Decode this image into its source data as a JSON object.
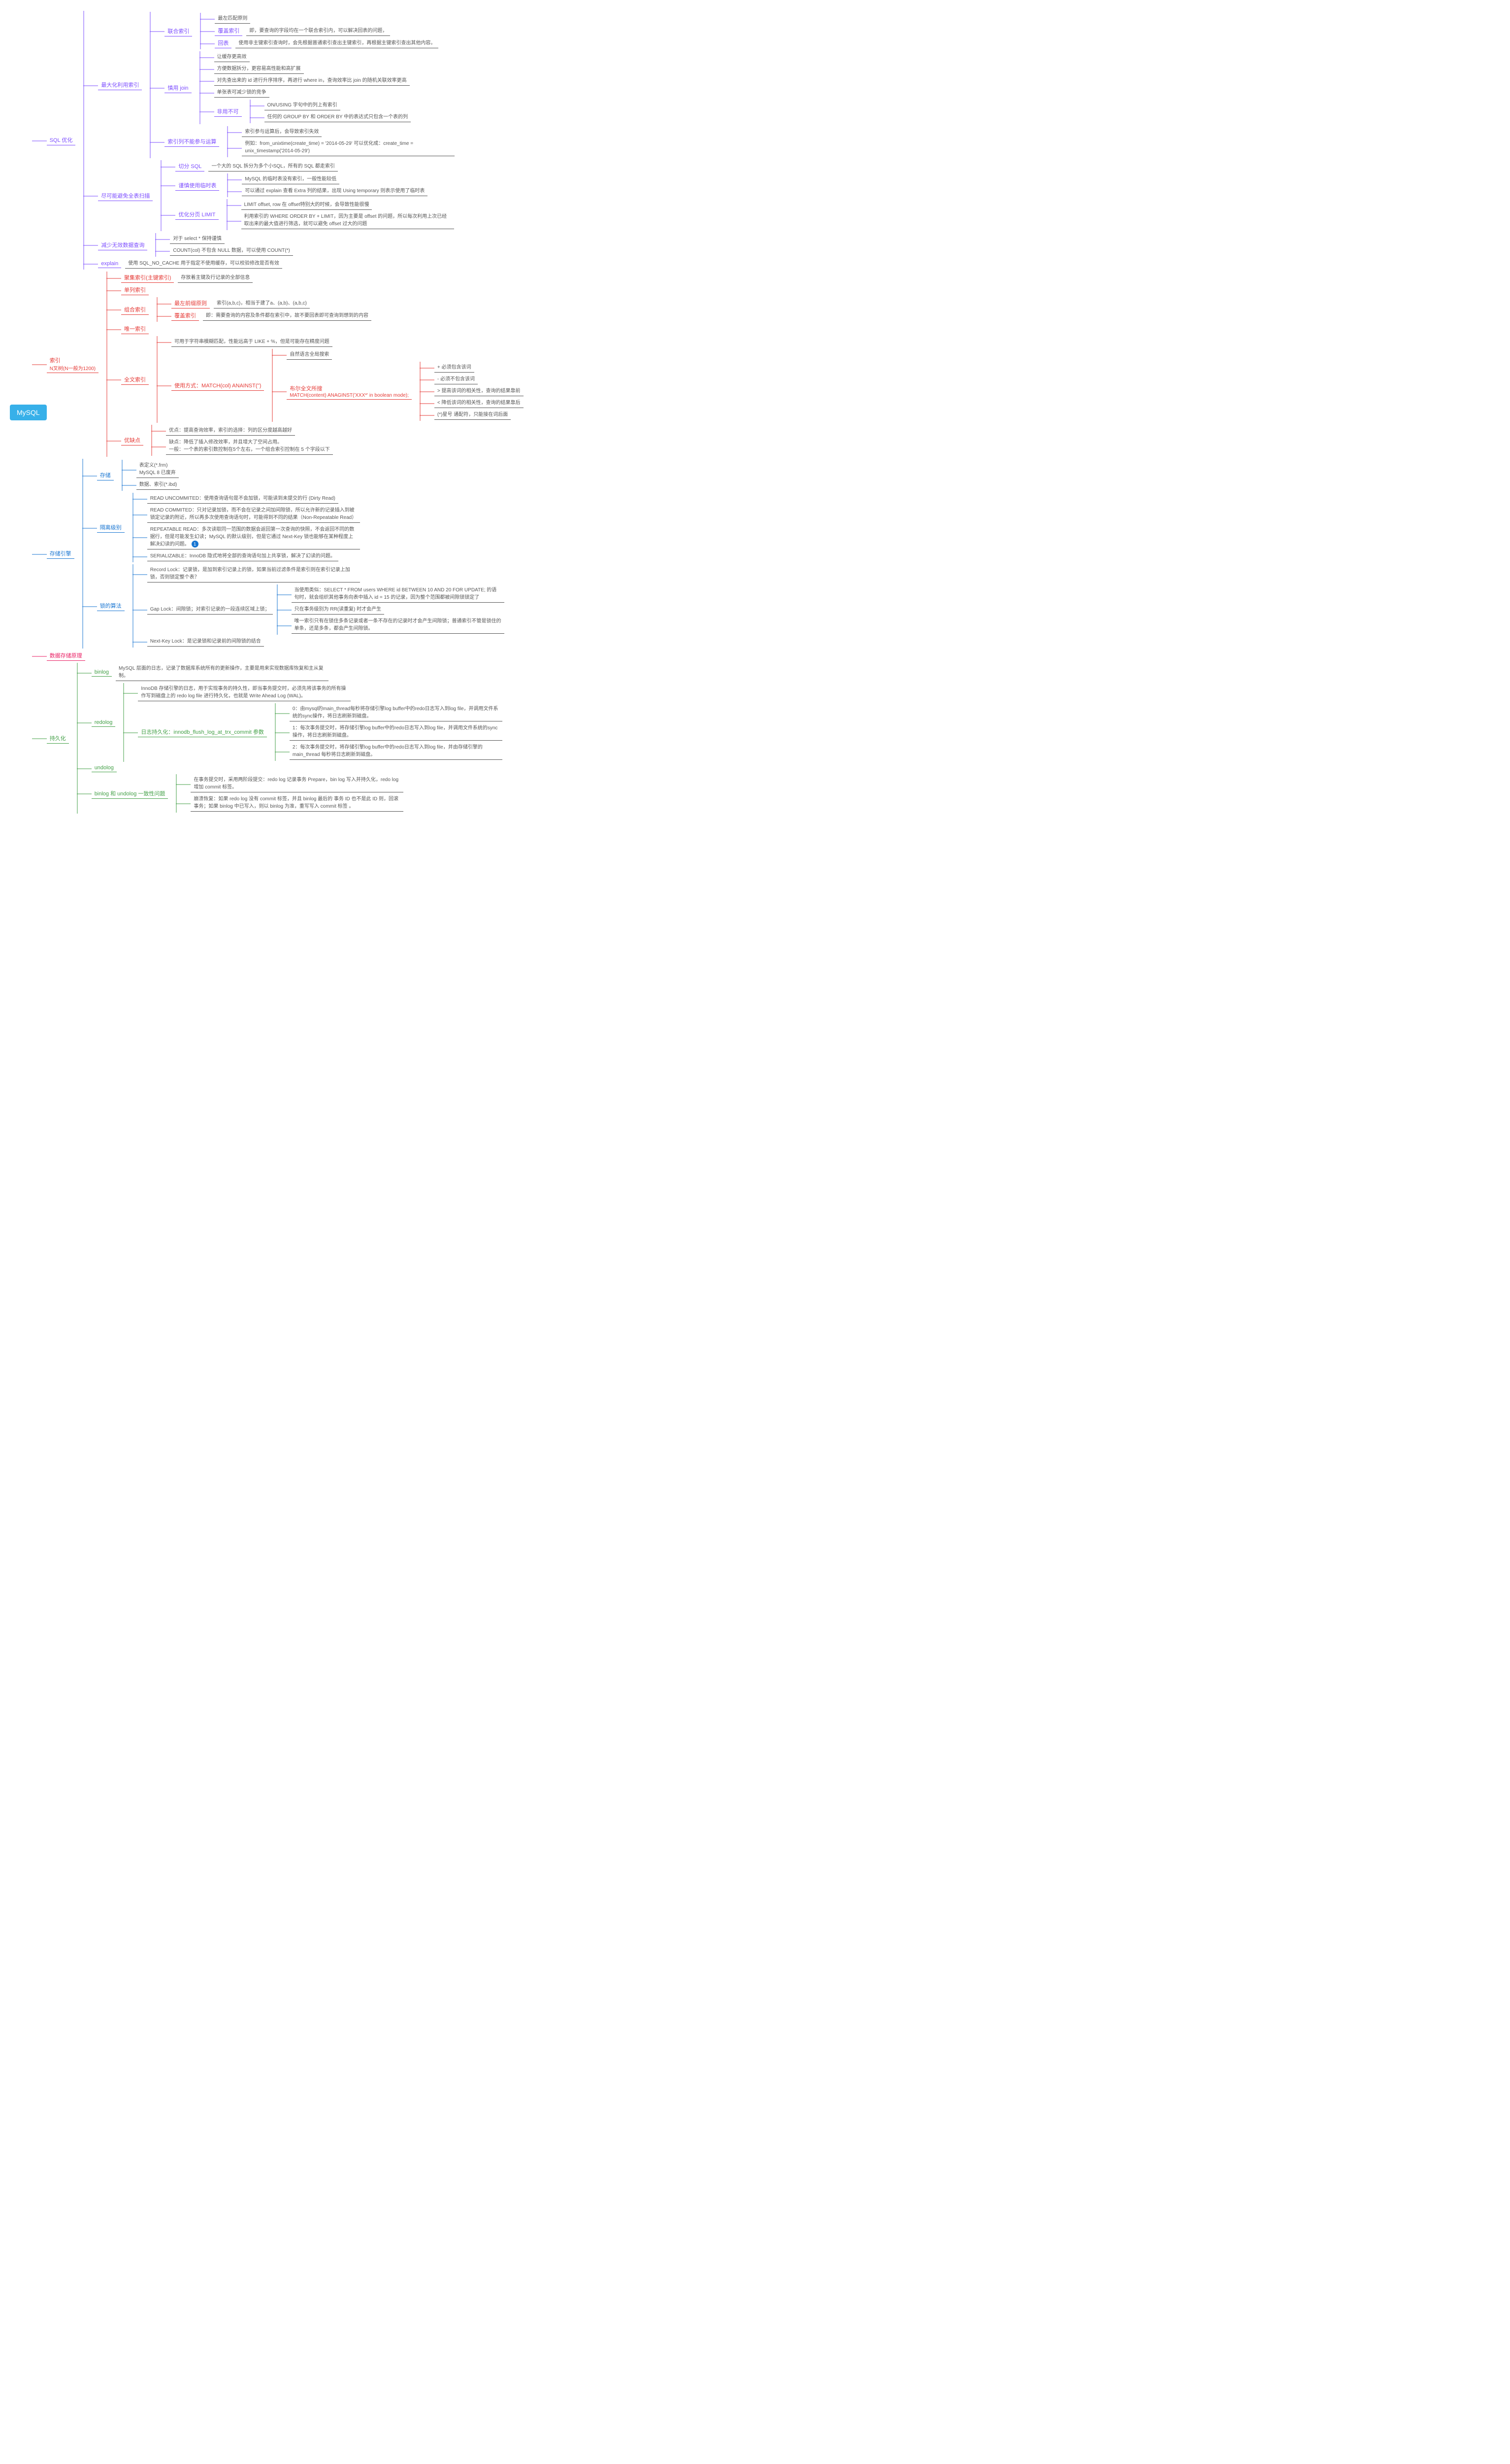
{
  "root": "MySQL",
  "badge": "1",
  "sqlopt": {
    "title": "SQL 优化",
    "maxIdx": {
      "title": "最大化利用索引",
      "union": {
        "title": "联合索引",
        "leftmost": "最左匹配原则",
        "cover": "覆盖索引",
        "coverDesc": "即，要查询的字段均在一个联合索引内，可以解决回表的问题，",
        "back": "回表",
        "backDesc": "使用非主键索引查询时，会先根据普通索引查出主键索引，再根据主键索引查出其他内容。"
      },
      "join": {
        "title": "慎用 join",
        "l1": "让缓存更高效",
        "l2": "方便数据拆分，更容易高性能和高扩展",
        "l3": "对先查出来的 id 进行升序排序，再进行 where in，查询效率比 join 的随机关联效率更高",
        "l4": "单张表可减少锁的竞争",
        "must": {
          "title": "非用不可",
          "l1": "ON/USING 字句中的列上有索引",
          "l2": "任何的 GROUP BY 和 ORDER BY 中的表达式只包含一个表的列"
        }
      },
      "nocalc": {
        "title": "索引列不能参与运算",
        "l1": "索引参与运算后，会导致索引失效",
        "l2": "例如：from_unixtime(create_time) = '2014-05-29' 可以优化成：create_time = unix_timestamp('2014-05-29')"
      }
    },
    "noscan": {
      "title": "尽可能避免全表扫描",
      "split": {
        "title": "切分 SQL",
        "desc": "一个大的 SQL 拆分为多个小SQL，所有的 SQL 都走索引"
      },
      "tmp": {
        "title": "谨慎使用临时表",
        "l1": "MySQL 的临时表没有索引，一般性能较低",
        "l2": "可以通过 explain 查看 Extra 列的结果，出现 Using temporary 则表示使用了临时表"
      },
      "limit": {
        "title": "优化分页 LIMIT",
        "l1": "LIMIT offset, row 在 offset特别大的时候，会导致性能很慢",
        "l2": "利用索引的 WHERE ORDER BY + LIMIT，因为主要是 offset 的问题，所以每次利用上次已经取出来的最大值进行筛选，就可以避免 offset 过大的问题"
      }
    },
    "reduce": {
      "title": "减少无效数据查询",
      "l1": "对于 select * 保持谨慎",
      "l2": "COUNT(col) 不包含 NULL 数据，可以使用 COUNT(*)"
    },
    "explain": {
      "title": "explain",
      "desc": "使用 SQL_NO_CACHE 用于指定不使用缓存，可以校验修改是否有效"
    }
  },
  "index": {
    "title": "索引",
    "subtitle": "N叉树(N一般为1200)",
    "cluster": {
      "title": "聚集索引(主键索引)",
      "desc": "存放着主键及行记录的全部信息"
    },
    "single": "单列索引",
    "combo": {
      "title": "组合索引",
      "l1t": "最左前缀原则",
      "l1d": "索引(a,b,c)，相当于建了a、(a,b)、(a,b,c)",
      "l2t": "覆盖索引",
      "l2d": "即：需要查询的内容及条件都在索引中，故不要回表即可查询到想到的内容"
    },
    "unique": "唯一索引",
    "fulltext": {
      "title": "全文索引",
      "l1": "可用于字符串模糊匹配，性能远高于 LIKE + %，但是可能存在精度问题",
      "use": {
        "title": "使用方式：MATCH(col) ANAINST('')",
        "l1": "自然语言全局搜索",
        "bool": {
          "title": "布尔全文所搜",
          "desc": "MATCH(content) ANAGINST('XXX*' in boolean mode);",
          "ops": [
            "+ 必须包含该词",
            "- 必须不包含该词",
            "> 提高该词的相关性，查询的结果靠前",
            "< 降低该词的相关性，查询的结果靠后",
            "(*)星号 通配符，只能接在词后面"
          ]
        }
      }
    },
    "pros": {
      "title": "优缺点",
      "l1": "优点：提高查询效率，索引的选择：列的区分度越高越好",
      "l2": "缺点：降低了插入修改效率，并且增大了空间占用。",
      "l3": "一般：一个表的索引数控制在5个左右，一个组合索引控制在 5 个字段以下"
    }
  },
  "engine": {
    "title": "存储引擎",
    "store": {
      "title": "存储",
      "l1": "表定义(*.frm)",
      "l2": "MySQL 8 已废弃",
      "l3": "数据、索引(*.ibd)"
    },
    "iso": {
      "title": "隔离级别",
      "ru": "READ UNCOMMITED：使用查询语句是不会加锁，可能读到未提交的行 (Dirty Read)",
      "rc": "READ COMMITED：只对记录加锁，而不会在记录之间加间隙锁，所以允许新的记录插入到被锁定记录的附近，所以再多次使用查询语句时，可能得到不同的结果（Non-Repeatable Read）",
      "rr": "REPEATABLE READ：多次读取同一范围的数据会返回第一次查询的快照，不会返回不同的数据行，但是可能发生幻读；MySQL 的默认级别，但是它通过 Next-Key 锁也能够在某种程度上解决幻读的问题。",
      "se": "SERIALIZABLE：InnoDB 隐式地将全部的查询语句加上共享锁，解决了幻读的问题。"
    },
    "locks": {
      "title": "锁的算法",
      "rec": "Record Lock：记录锁，是加到索引记录上的锁，如果当前过滤条件是索引则在索引记录上加锁，否则锁定整个表？",
      "gap": {
        "title": "Gap Lock：间隙锁；对索引记录的一段连续区域上锁；",
        "l1": "当使用类似：SELECT * FROM users WHERE id BETWEEN 10 AND 20 FOR UPDATE; 的语句时，就会组织其他事务向表中插入 id = 15 的记录，因为整个范围都被间隙锁锁定了",
        "l2": "只在事务级别为 RR(读重复) 时才会产生",
        "l3": "唯一索引只有在锁住多条记录或者一条不存在的记录时才会产生间隙锁；普通索引不管是锁住的单条，还是多条，都会产生间隙锁。"
      },
      "next": "Next-Key Lock：是记录锁和记录前的间隙锁的结合"
    }
  },
  "storage": "数据存储原理",
  "durable": {
    "title": "持久化",
    "binlog": {
      "title": "binlog",
      "desc": "MySQL 层面的日志，记录了数据库系统所有的更新操作，主要是用来实现数据库恢复和主从复制。"
    },
    "redolog": {
      "title": "redolog",
      "desc": "InnoDB 存储引擎的日志，用于实现事务的持久性，即当事务提交时，必须先将该事务的所有操作写到磁盘上的 redo log file 进行持久化，也就是 Write Ahead Log (WAL)。",
      "flush": {
        "title": "日志持久化：innodb_flush_log_at_trx_commit 参数",
        "l0": "0：由mysql的main_thread每秒将存储引擎log buffer中的redo日志写入到log file，并调用文件系统的sync操作，将日志刷新到磁盘。",
        "l1": "1：每次事务提交时，将存储引擎log buffer中的redo日志写入到log file，并调用文件系统的sync操作，将日志刷新到磁盘。",
        "l2": "2：每次事务提交时，将存储引擎log buffer中的redo日志写入到log file，并由存储引擎的main_thread 每秒将日志刷新到磁盘。"
      }
    },
    "undolog": "undolog",
    "consistent": {
      "title": "binlog 和 undolog 一致性问题",
      "l1": "在事务提交时，采用两阶段提交：redo log 记录事务 Prepare，bin log 写入并持久化，redo log 增加 commit 标签。",
      "l2": "崩溃恢复：如果 redo log 没有 commit 标签，并且 binlog 最后的 事务 ID 也不是此 ID 则，回滚事务；如果 binlog 中已写入，则以 binlog 为准，重写写入 commit 标签 。"
    }
  }
}
